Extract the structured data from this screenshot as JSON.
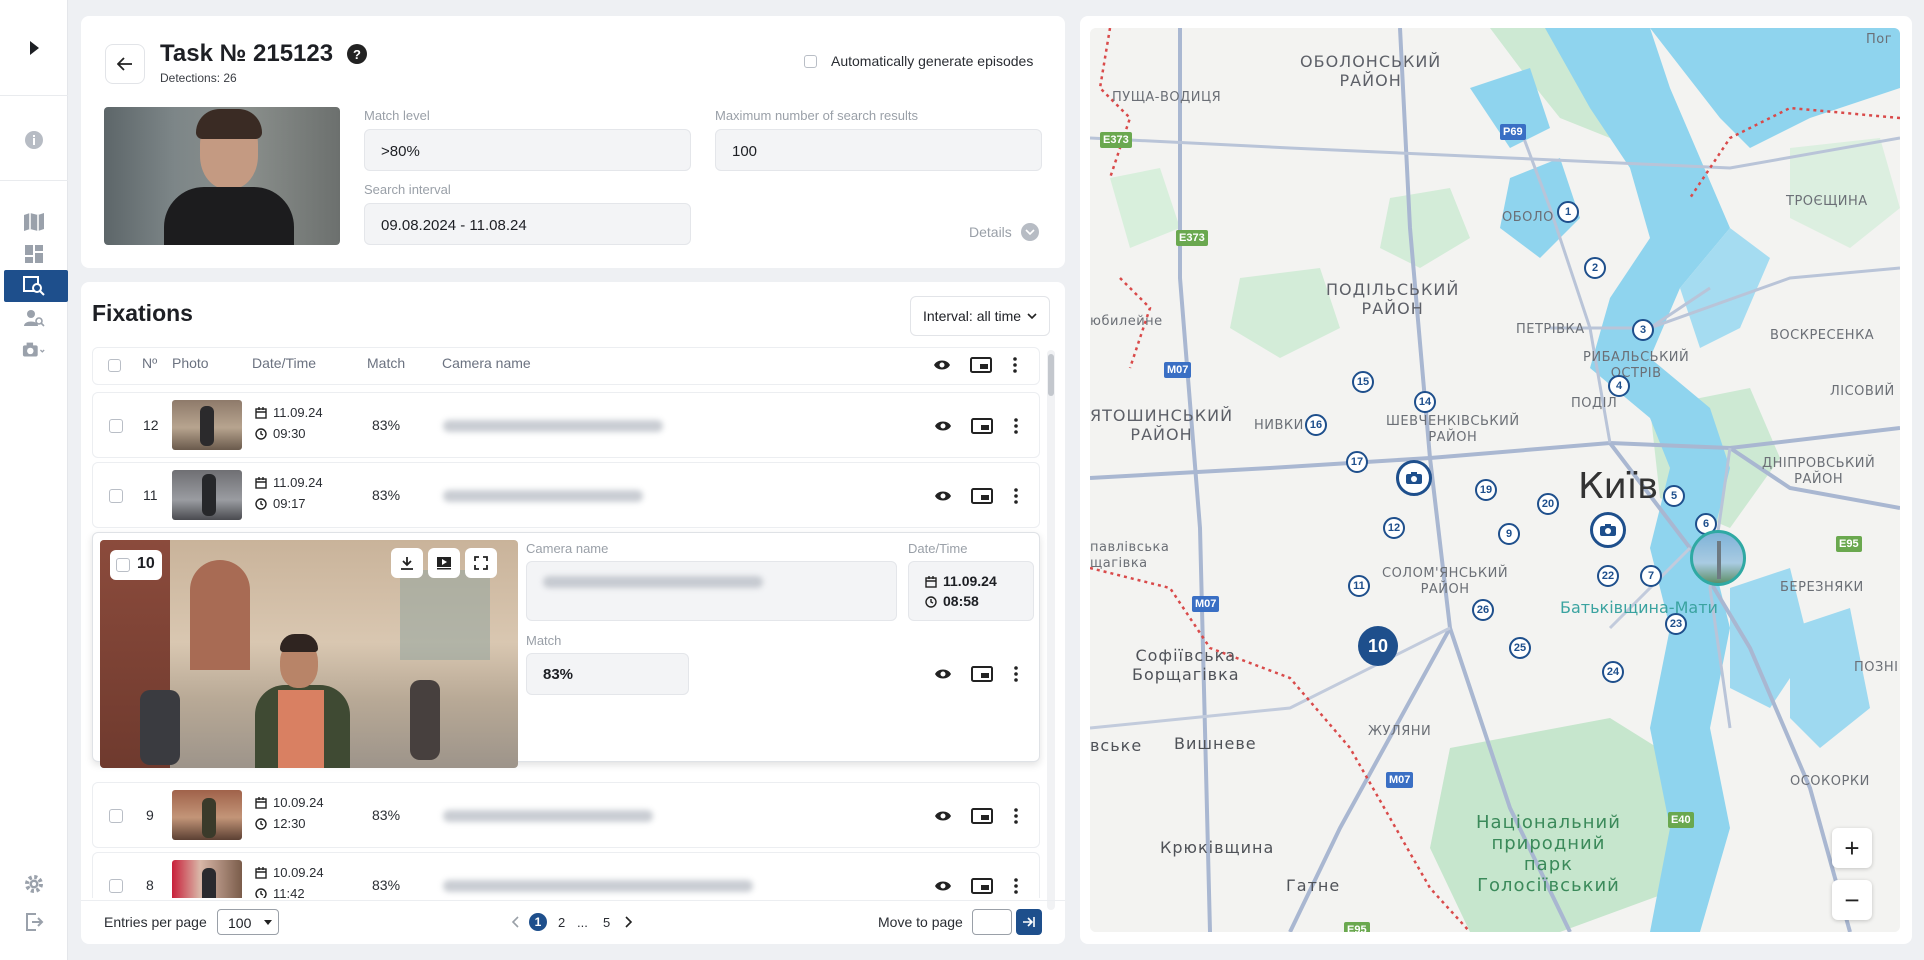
{
  "task": {
    "title": "Task № 215123",
    "detections": "Detections: 26",
    "auto_label": "Automatically generate episodes",
    "match_label": "Match level",
    "match_value": ">80%",
    "max_label": "Maximum number of search results",
    "max_value": "100",
    "interval_label": "Search interval",
    "interval_value": "09.08.2024 - 11.08.24",
    "details": "Details"
  },
  "fixations": {
    "title": "Fixations",
    "interval_select": "Interval: all time",
    "columns": {
      "no": "Nº",
      "photo": "Photo",
      "datetime": "Date/Time",
      "match": "Match",
      "camera": "Camera name"
    },
    "rows": [
      {
        "no": "12",
        "date": "11.09.24",
        "time": "09:30",
        "match": "83%"
      },
      {
        "no": "11",
        "date": "11.09.24",
        "time": "09:17",
        "match": "83%"
      },
      {
        "no": "9",
        "date": "10.09.24",
        "time": "12:30",
        "match": "83%"
      },
      {
        "no": "8",
        "date": "10.09.24",
        "time": "11:42",
        "match": "83%"
      }
    ],
    "expanded": {
      "no": "10",
      "camera_label": "Camera name",
      "datetime_label": "Date/Time",
      "date": "11.09.24",
      "time": "08:58",
      "match_label": "Match",
      "match": "83%"
    },
    "footer": {
      "entries_label": "Entries per page",
      "entries_value": "100",
      "pages": [
        "1",
        "2",
        "...",
        "5"
      ],
      "move_label": "Move to page"
    }
  },
  "map": {
    "labels": {
      "obolon_district": "ОБОЛОНСЬКИЙ\nРАЙОН",
      "pushcha": "ПУЩА-ВОДИЦЯ",
      "obolon": "ОБОЛО",
      "podil_district": "ПОДІЛЬСЬКИЙ\nРАЙОН",
      "petrivka": "ПЕТРІВКА",
      "rybalskyi": "РИБАЛЬСЬКИЙ\nОСТРІВ",
      "podil": "ПОДІЛ",
      "troieshchyna": "ТРОЄЩИНА",
      "voskresenka": "ВОСКРЕСЕНКА",
      "lisovyi": "ЛІСОВИЙ",
      "sviatoshyn": "ЯТОШИНСЬКИЙ\nРАЙОН",
      "nyvky": "НИВКИ",
      "shevchenko": "ШЕВЧЕНКІВСЬКИЙ\nРАЙОН",
      "kyiv": "Київ",
      "dnipro": "ДНІПРОВСЬКИЙ\nРАЙОН",
      "pavlivska": "павлівська\nщагівка",
      "solomianskyi": "СОЛОМ'ЯНСЬКИЙ\nРАЙОН",
      "mother": "Батьківщина-Мати",
      "bereznyaki": "БЕРЕЗНЯКИ",
      "sofiivska": "Софіївська\nБорщагівка",
      "pozni": "ПОЗНІ",
      "vske": "вське",
      "vyshneve": "Вишневе",
      "zhuliany": "ЖУЛЯНИ",
      "osokorky": "ОСОКОРКИ",
      "park": "Національний\nприродний\nпарк\nГолосіївський",
      "kriukivshchyna": "Крюківщина",
      "hatne": "Гатне",
      "yubileine": "юбилейне",
      "pog": "Пог"
    },
    "roads": [
      "E373",
      "E373",
      "P69",
      "M07",
      "M07",
      "M07",
      "E95",
      "E40",
      "E95"
    ],
    "pins": [
      "1",
      "2",
      "3",
      "4",
      "5",
      "6",
      "7",
      "9",
      "11",
      "12",
      "14",
      "15",
      "16",
      "17",
      "19",
      "20",
      "22",
      "23",
      "24",
      "25",
      "26"
    ],
    "cluster_big": "10",
    "zoom_in": "+",
    "zoom_out": "−",
    "colors": {
      "water": "#8fd4ee",
      "green": "#c8e8cf",
      "road": "#a9b7d1",
      "accent": "#1e4f8c"
    }
  }
}
